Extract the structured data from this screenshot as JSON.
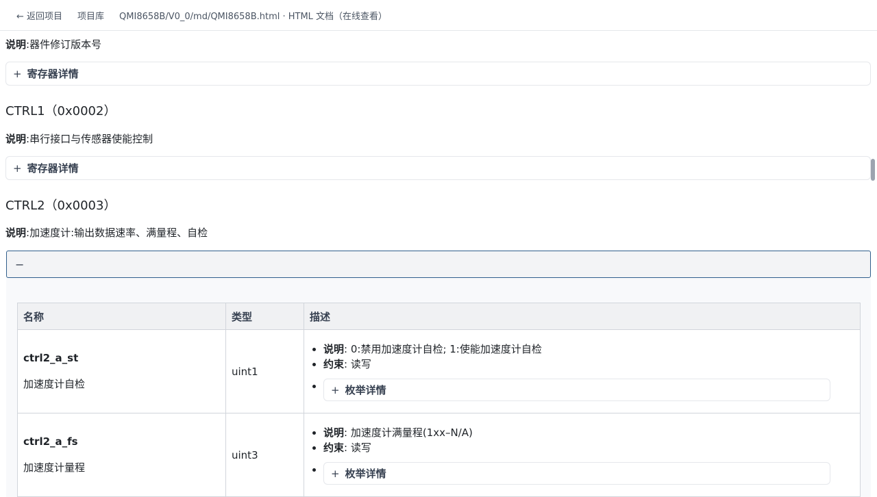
{
  "breadcrumb": {
    "back": "← 返回项目",
    "library": "项目库",
    "path": "QMI8658B/V0_0/md/QMI8658B.html · HTML 文档（在线查看）"
  },
  "labels": {
    "desc_prefix": "说明",
    "register_details": "寄存器详情",
    "plus": "+",
    "minus": "−"
  },
  "top_desc": "器件修订版本号",
  "sections": [
    {
      "title": "CTRL1（0x0002）",
      "desc": "串行接口与传感器使能控制"
    },
    {
      "title": "CTRL2（0x0003）",
      "desc": "加速度计:输出数据速率、满量程、自检"
    }
  ],
  "table": {
    "headers": [
      "名称",
      "类型",
      "描述"
    ],
    "rows": [
      {
        "name": "ctrl2_a_st",
        "cn": "加速度计自检",
        "type": "uint1",
        "desc_label": "说明",
        "desc": "0:禁用加速度计自检; 1:使能加速度计自检",
        "cons_label": "约束",
        "cons": "读写",
        "enum": "枚举详情"
      },
      {
        "name": "ctrl2_a_fs",
        "cn": "加速度计量程",
        "type": "uint3",
        "desc_label": "说明",
        "desc": "加速度计满量程(1xx–N/A)",
        "cons_label": "约束",
        "cons": "读写",
        "enum": "枚举详情"
      }
    ]
  }
}
